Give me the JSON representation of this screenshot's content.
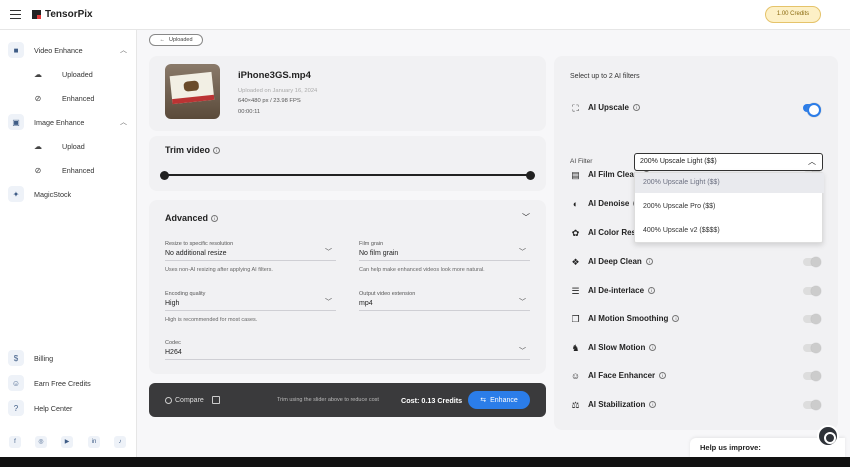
{
  "brand": {
    "name": "TensorPix"
  },
  "credits": {
    "label": "1.00 Credits"
  },
  "sidebar": {
    "video_enhance": "Video Enhance",
    "video_uploaded": "Uploaded",
    "video_enhanced": "Enhanced",
    "image_enhance": "Image Enhance",
    "image_upload": "Upload",
    "image_enhanced": "Enhanced",
    "magicstock": "MagicStock",
    "billing": "Billing",
    "earn": "Earn Free Credits",
    "help": "Help Center",
    "social": [
      "facebook-icon",
      "instagram-icon",
      "youtube-icon",
      "linkedin-icon",
      "tiktok-icon"
    ]
  },
  "back": {
    "label": "Uploaded"
  },
  "file": {
    "name": "iPhone3GS.mp4",
    "uploaded": "Uploaded on January 16, 2024",
    "specs": "640×480 px / 23.98 FPS",
    "duration": "00:00:11"
  },
  "trim": {
    "title": "Trim video",
    "start_fraction": 0.0,
    "end_fraction": 1.0
  },
  "advanced": {
    "title": "Advanced",
    "resize": {
      "label": "Resize to specific resolution",
      "value": "No additional resize",
      "help": "Uses non-AI resizing after applying AI filters."
    },
    "grain": {
      "label": "Film grain",
      "value": "No film grain",
      "help": "Can help make enhanced videos look more natural."
    },
    "quality": {
      "label": "Encoding quality",
      "value": "High",
      "help": "High is recommended for most cases."
    },
    "extension": {
      "label": "Output video extension",
      "value": "mp4"
    },
    "codec": {
      "label": "Codec",
      "value": "H264"
    }
  },
  "bottom": {
    "compare": "Compare",
    "trim_note": "Trim using the slider above to reduce cost",
    "cost": "Cost: 0.13 Credits",
    "enhance": "Enhance"
  },
  "filters": {
    "heading": "Select up to 2 AI filters",
    "ai_filter_label": "AI Filter",
    "selected": "200% Upscale Light ($$)",
    "options": [
      "200% Upscale Light ($$)",
      "200% Upscale Pro ($$)",
      "400% Upscale v2 ($$$$)"
    ],
    "items": [
      {
        "name": "AI Upscale",
        "icon": "upscale-icon",
        "on": true
      },
      {
        "name": "AI Film Clean",
        "icon": "film-icon",
        "on": false
      },
      {
        "name": "AI Denoise",
        "icon": "denoise-icon",
        "on": false
      },
      {
        "name": "AI Color Restore",
        "icon": "palette-icon",
        "on": false
      },
      {
        "name": "AI Deep Clean",
        "icon": "deep-clean-icon",
        "on": false
      },
      {
        "name": "AI De-interlace",
        "icon": "deinterlace-icon",
        "on": false
      },
      {
        "name": "AI Motion Smoothing",
        "icon": "motion-smoothing-icon",
        "on": false
      },
      {
        "name": "AI Slow Motion",
        "icon": "slow-motion-icon",
        "on": false
      },
      {
        "name": "AI Face Enhancer",
        "icon": "face-icon",
        "on": false
      },
      {
        "name": "AI Stabilization",
        "icon": "stabilization-icon",
        "on": false
      }
    ]
  },
  "help_widget": {
    "label": "Help us improve:"
  }
}
